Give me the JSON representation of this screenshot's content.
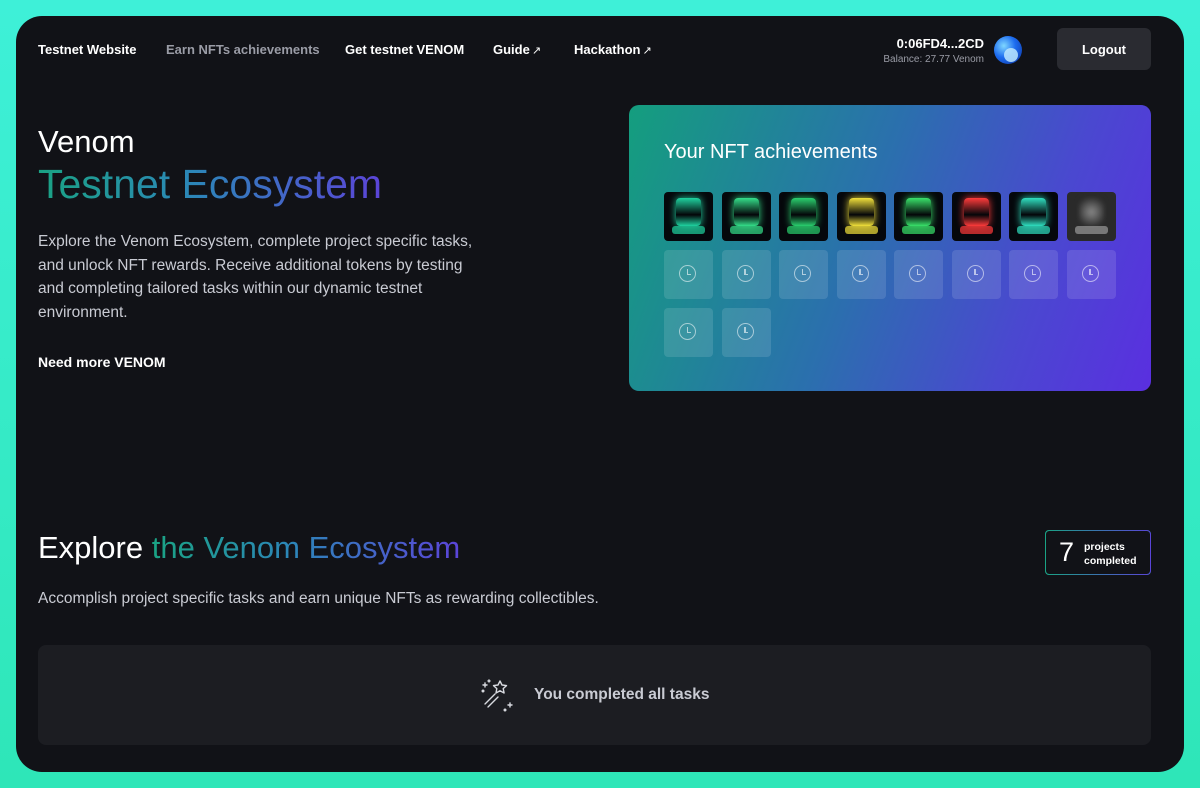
{
  "nav": {
    "links": [
      {
        "label": "Testnet Website"
      },
      {
        "label": "Earn NFTs achievements"
      },
      {
        "label": "Get testnet VENOM"
      },
      {
        "label": "Guide",
        "external": "↗"
      },
      {
        "label": "Hackathon",
        "external": "↗"
      }
    ],
    "wallet_address": "0:06FD4...2CD",
    "balance": "Balance: 27.77 Venom",
    "logout_label": "Logout"
  },
  "hero": {
    "title_line1": "Venom",
    "title_line2": "Testnet Ecosystem",
    "description": "Explore the Venom Ecosystem, complete project specific tasks, and unlock NFT rewards. Receive additional tokens by testing and completing tailored tasks within our dynamic testnet environment.",
    "need_more_link": "Need more VENOM"
  },
  "nft_card": {
    "title": "Your NFT achievements",
    "earned_nft_colors": [
      "#1fd3a0",
      "#34e08a",
      "#2ad06e",
      "#f2e13a",
      "#39e36a",
      "#ff3b3b",
      "#2fe0c0",
      "#9a9a9a"
    ],
    "pending_slots": 10,
    "pending_icon": "clock-icon"
  },
  "explore": {
    "title_plain": "Explore ",
    "title_gradient": "the Venom Ecosystem",
    "description": "Accomplish project specific tasks and earn unique NFTs as rewarding collectibles.",
    "projects_completed": "7",
    "projects_completed_label": "projects completed",
    "tasks_message": "You completed all tasks",
    "tasks_icon": "magic-wand-icon"
  },
  "colors": {
    "background": "#111217",
    "accent_green": "#1aa384",
    "accent_purple": "#5a2fe0",
    "card": "#1c1d22"
  }
}
